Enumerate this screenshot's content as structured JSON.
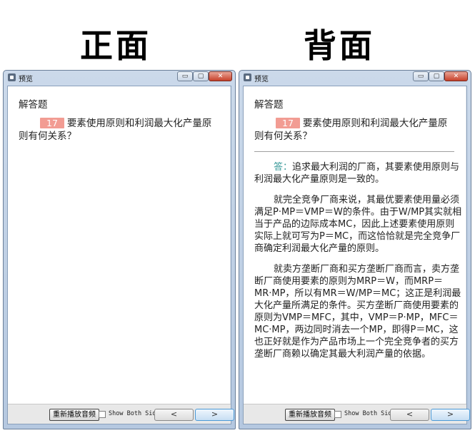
{
  "headings": {
    "front": "正面",
    "back": "背面"
  },
  "window": {
    "title": "预览",
    "controls": {
      "minimize": "▭",
      "maximize": "▢",
      "close": "✕"
    }
  },
  "card": {
    "section_title": "解答题",
    "question_number": "17",
    "question_text": "要素使用原则和利润最大化产量原则有何关系？",
    "answer_label": "答：",
    "answer_paragraphs": [
      "追求最大利润的厂商，其要素使用原则与利润最大化产量原则是一致的。",
      "就完全竞争厂商来说，其最优要素使用量必须满足P·MP＝VMP＝W的条件。由于W/MP其实就相当于产品的边际成本MC，因此上述要素使用原则实际上就可写为P＝MC，而这恰恰就是完全竞争厂商确定利润最大化产量的原则。",
      "就卖方垄断厂商和买方垄断厂商而言，卖方垄断厂商使用要素的原则为MRP＝W，而MRP＝MR·MP，所以有MR＝W/MP＝MC；这正是利润最大化产量所满足的条件。买方垄断厂商使用要素的原则为VMP＝MFC，其中，VMP＝P·MP，MFC＝MC·MP，两边同时消去一个MP，即得P＝MC，这也正好就是作为产品市场上一个完全竞争者的买方垄断厂商赖以确定其最大利润产量的依据。"
    ]
  },
  "bottombar": {
    "replay_label": "重新播放音频",
    "show_both_label": "Show Both Sides",
    "prev_label": "<",
    "next_label": ">"
  }
}
